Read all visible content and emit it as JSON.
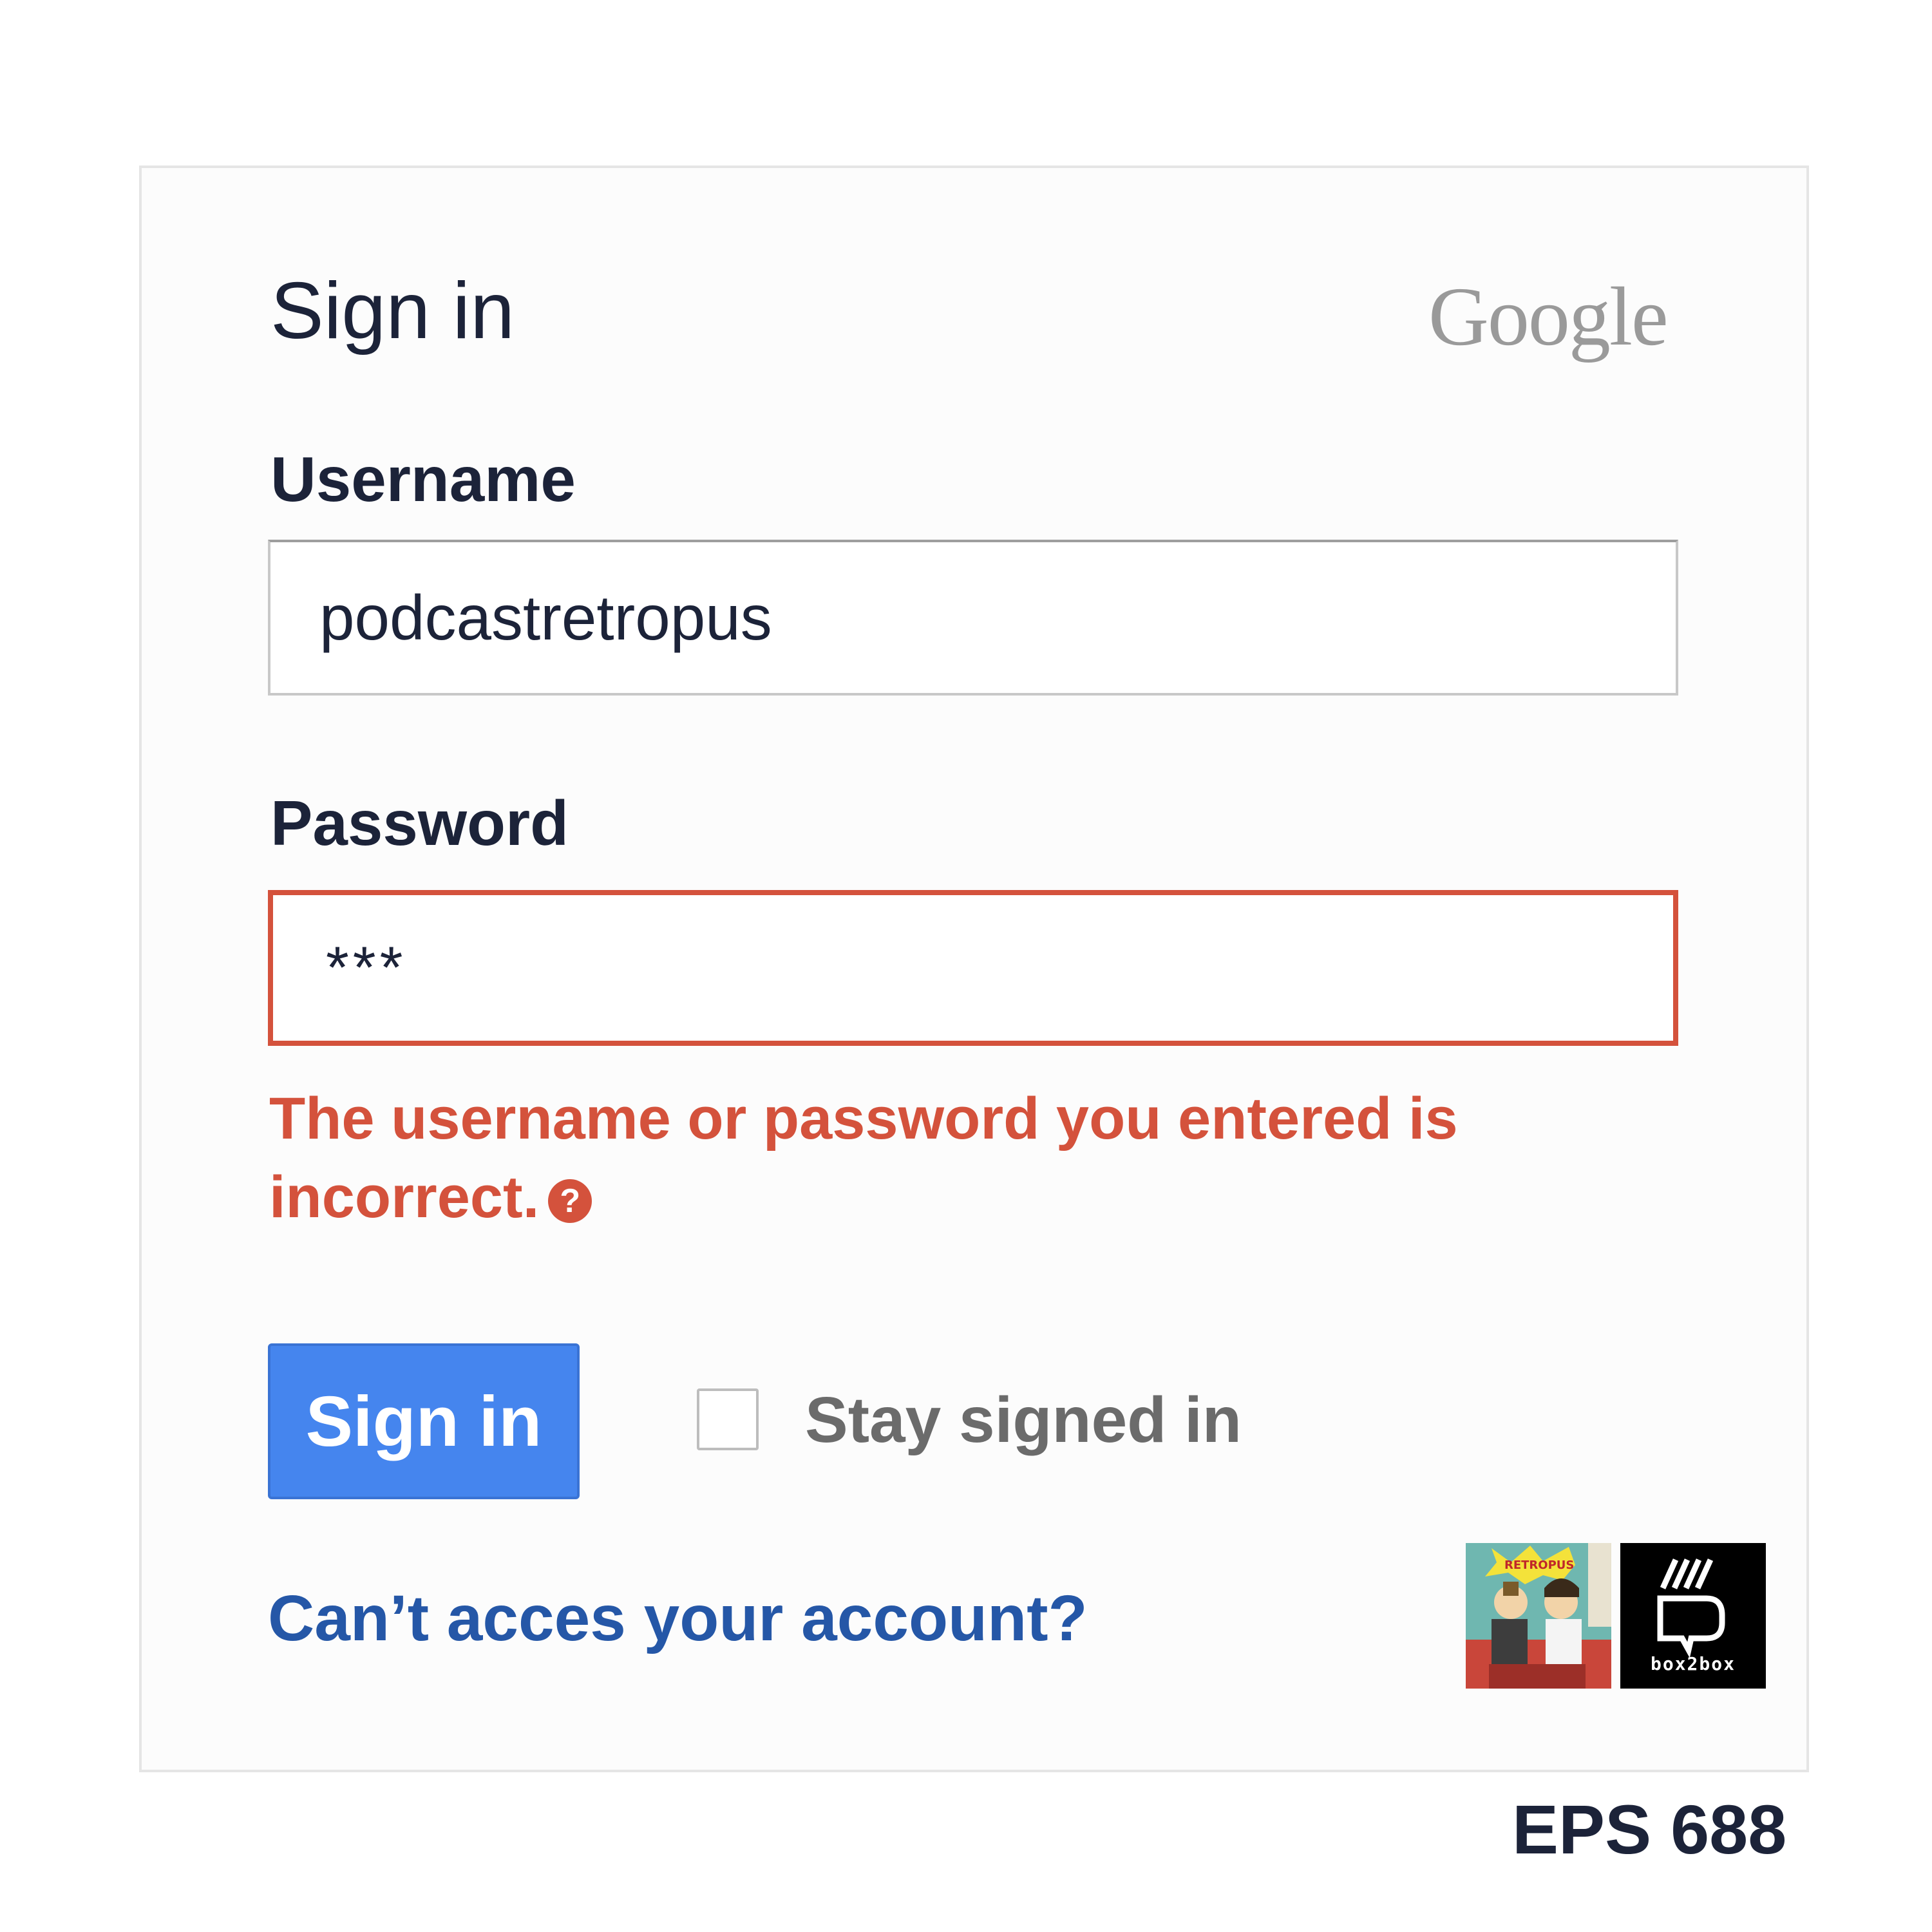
{
  "form": {
    "title": "Sign in",
    "brand": "Google",
    "username": {
      "label": "Username",
      "value": "podcastretropus"
    },
    "password": {
      "label": "Password",
      "value": "***"
    },
    "error": {
      "message": "The username or password you entered is incorrect.",
      "help_glyph": "?"
    },
    "submit_label": "Sign in",
    "stay_signed_in_label": "Stay signed in",
    "help_link": "Can’t acces your account?"
  },
  "logos": {
    "retropus_text": "RETROPUS",
    "box2box_text": "box2box"
  },
  "episode": "EPS 688",
  "colors": {
    "text_dark": "#1c2339",
    "error_red": "#d4523c",
    "button_blue": "#4585ee",
    "link_blue": "#2557a7",
    "google_grey": "#9a9a9a"
  }
}
